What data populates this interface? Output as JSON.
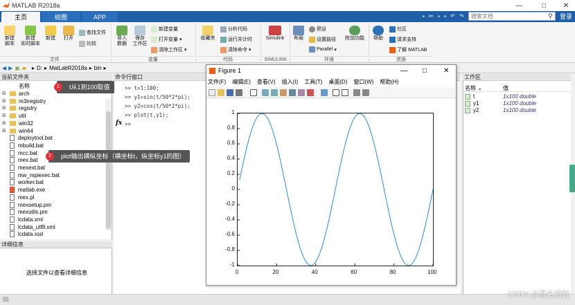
{
  "window": {
    "title": "MATLAB R2018a"
  },
  "tabs": [
    "主页",
    "绘图",
    "APP"
  ],
  "search": {
    "placeholder": "搜索文档"
  },
  "login_label": "登录",
  "ribbon": {
    "file": {
      "new_script": "新建\n脚本",
      "new_live": "新建\n实时脚本",
      "new": "新建",
      "open": "打开",
      "find_files": "查找文件",
      "compare": "比较",
      "group": "文件"
    },
    "variable": {
      "import": "导入\n数据",
      "save_ws": "保存\n工作区",
      "new_var": "新建变量",
      "open_var": "打开变量",
      "clear_ws": "清除工作区",
      "group": "变量"
    },
    "code": {
      "favorites": "收藏夹",
      "analyze": "分析代码",
      "run_time": "运行并计时",
      "clear_cmd": "清除命令",
      "group": "代码"
    },
    "simulink": {
      "label": "Simulink",
      "group": "SIMULINK"
    },
    "env": {
      "layout": "布局",
      "prefs": "预设",
      "set_path": "设置路径",
      "parallel": "Parallel",
      "addons": "附加功能",
      "group": "环境"
    },
    "resources": {
      "help": "帮助",
      "community": "社区",
      "support": "请求支持",
      "learn": "了解 MATLAB",
      "group": "资源"
    }
  },
  "address": {
    "path": [
      "D:",
      "MatLabR2018a",
      "bin"
    ]
  },
  "current_folder": {
    "header": "当前文件夹",
    "col_name": "名称",
    "items": [
      {
        "name": "arch",
        "type": "folder"
      },
      {
        "name": "m3iregistry",
        "type": "folder"
      },
      {
        "name": "registry",
        "type": "folder"
      },
      {
        "name": "util",
        "type": "folder"
      },
      {
        "name": "win32",
        "type": "folder"
      },
      {
        "name": "win64",
        "type": "folder"
      },
      {
        "name": "deploytool.bat",
        "type": "file"
      },
      {
        "name": "mbuild.bat",
        "type": "file"
      },
      {
        "name": "mcc.bat",
        "type": "file"
      },
      {
        "name": "mex.bat",
        "type": "file"
      },
      {
        "name": "mexext.bat",
        "type": "file"
      },
      {
        "name": "mw_mpiexec.bat",
        "type": "file"
      },
      {
        "name": "worker.bat",
        "type": "file"
      },
      {
        "name": "matlab.exe",
        "type": "exe"
      },
      {
        "name": "mex.pl",
        "type": "file"
      },
      {
        "name": "mexsetup.pm",
        "type": "file"
      },
      {
        "name": "mexutils.pm",
        "type": "file"
      },
      {
        "name": "lcdata.xml",
        "type": "file"
      },
      {
        "name": "lcdata_utf8.xml",
        "type": "file"
      },
      {
        "name": "lcdata.xsd",
        "type": "file"
      }
    ]
  },
  "details": {
    "header": "详细信息",
    "empty_text": "选择文件以查看详细信息"
  },
  "command_window": {
    "header": "命令行窗口",
    "lines": [
      ">> t=1:100;",
      ">> y1=sin(t/50*2*pi);",
      ">> y2=cos(t/50*2*pi);",
      ">> plot(t,y1);",
      ">>"
    ],
    "prompt_symbol": "fx"
  },
  "workspace": {
    "header": "工作区",
    "col_name": "名称 ⌄",
    "col_value": "值",
    "vars": [
      {
        "name": "t",
        "value": "1x100 double"
      },
      {
        "name": "y1",
        "value": "1x100 double"
      },
      {
        "name": "y2",
        "value": "1x100 double"
      }
    ]
  },
  "figure": {
    "title": "Figure 1",
    "menu": [
      "文件(F)",
      "编辑(E)",
      "查看(V)",
      "插入(I)",
      "工具(T)",
      "桌面(D)",
      "窗口(W)",
      "帮助(H)"
    ]
  },
  "annotations": [
    {
      "num": "1",
      "text": "t从1到100取值"
    },
    {
      "num": "2",
      "text": "plot输出横纵坐标（横坐标t，纵坐标y1的图）"
    }
  ],
  "watermark": "CSDN @吾名招财",
  "chart_data": {
    "type": "line",
    "title": "",
    "xlabel": "",
    "ylabel": "",
    "xlim": [
      0,
      100
    ],
    "ylim": [
      -1,
      1
    ],
    "x_ticks": [
      0,
      20,
      40,
      60,
      80,
      100
    ],
    "y_ticks": [
      -1,
      -0.8,
      -0.6,
      -0.4,
      -0.2,
      0,
      0.2,
      0.4,
      0.6,
      0.8,
      1
    ],
    "series": [
      {
        "function": "y1 = sin(t/50*2*pi)",
        "x": [
          1,
          100
        ],
        "color": "#2e8bd0"
      }
    ],
    "grid": false
  }
}
